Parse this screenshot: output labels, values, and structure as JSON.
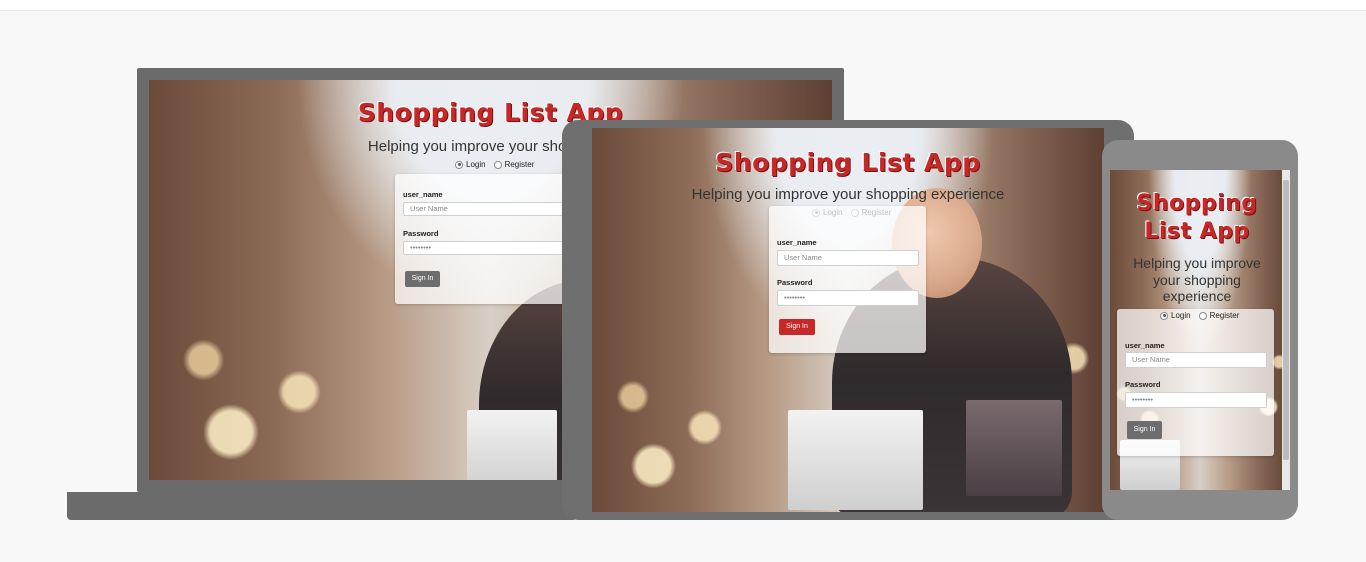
{
  "app": {
    "title": "Shopping List App",
    "title_line1": "Shopping",
    "title_line2": "List App",
    "subtitle": "Helping you improve your shopping experience",
    "subtitle_laptop_visible": "Helping you improve your shopping",
    "subtitle_phone_line1": "Helping you improve",
    "subtitle_phone_line2": "your shopping",
    "subtitle_phone_line3": "experience"
  },
  "auth_tabs": {
    "login": "Login",
    "register": "Register",
    "selected": "Login"
  },
  "form": {
    "username_label": "user_name",
    "username_placeholder": "User Name",
    "password_label": "Password",
    "password_value": "••••••••",
    "submit_label": "Sign In"
  },
  "colors": {
    "title_red": "#c62828",
    "signin_gray": "#6d6d6d",
    "signin_red": "#c62828",
    "device_frame": "#6b6b6b"
  },
  "devices": [
    "laptop",
    "tablet",
    "phone"
  ]
}
